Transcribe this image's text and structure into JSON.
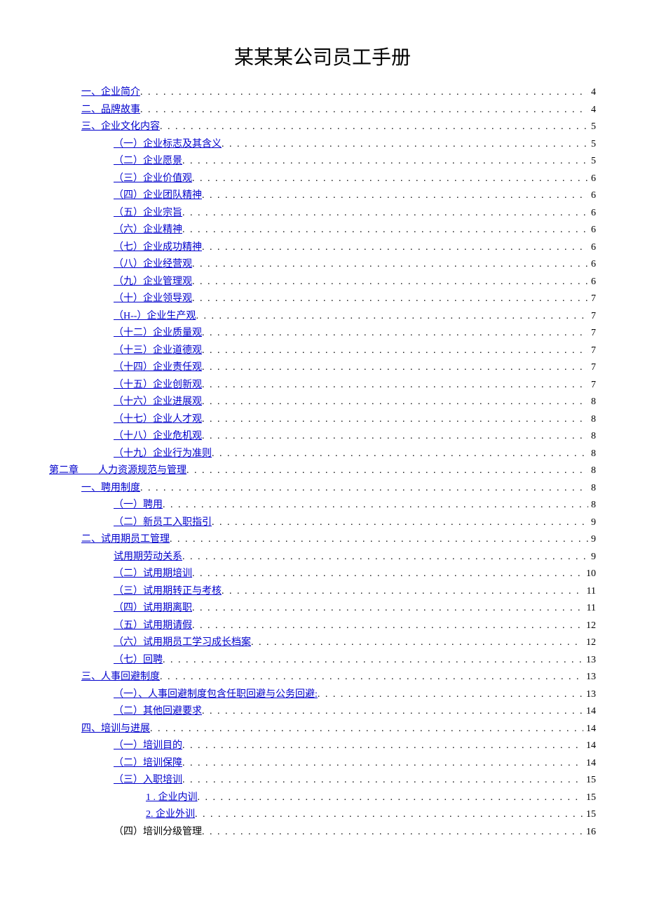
{
  "title": "某某某公司员工手册",
  "toc": [
    {
      "label": "一、企业简介",
      "page": "4",
      "indent": 1,
      "link": true
    },
    {
      "label": "二、品牌故事",
      "page": "4",
      "indent": 1,
      "link": true
    },
    {
      "label": "三、企业文化内容",
      "page": "5",
      "indent": 1,
      "link": true
    },
    {
      "label": "（一）企业标志及其含义",
      "page": "5",
      "indent": 2,
      "link": true
    },
    {
      "label": "（二）企业愿景",
      "page": "5",
      "indent": 2,
      "link": true
    },
    {
      "label": "（三）企业价值观",
      "page": "6",
      "indent": 2,
      "link": true
    },
    {
      "label": "（四）企业团队精神",
      "page": "6",
      "indent": 2,
      "link": true
    },
    {
      "label": "（五）企业宗旨",
      "page": "6",
      "indent": 2,
      "link": true
    },
    {
      "label": "（六）企业精神",
      "page": "6",
      "indent": 2,
      "link": true
    },
    {
      "label": "（七）企业成功精神",
      "page": "6",
      "indent": 2,
      "link": true
    },
    {
      "label": "（八）企业经营观",
      "page": "6",
      "indent": 2,
      "link": true
    },
    {
      "label": "（九）企业管理观",
      "page": "6",
      "indent": 2,
      "link": true
    },
    {
      "label": "（十）企业领导观",
      "page": "7",
      "indent": 2,
      "link": true
    },
    {
      "label": "（H--）企业生产观",
      "page": "7",
      "indent": 2,
      "link": true
    },
    {
      "label": "（十二）企业质量观",
      "page": "7",
      "indent": 2,
      "link": true
    },
    {
      "label": "（十三）企业道德观",
      "page": "7",
      "indent": 2,
      "link": true
    },
    {
      "label": "（十四）企业责任观",
      "page": "7",
      "indent": 2,
      "link": true
    },
    {
      "label": "（十五）企业创新观",
      "page": "7",
      "indent": 2,
      "link": true
    },
    {
      "label": "（十六）企业进展观",
      "page": "8",
      "indent": 2,
      "link": true
    },
    {
      "label": "（十七）企业人才观",
      "page": "8",
      "indent": 2,
      "link": true
    },
    {
      "label": "（十八）企业危机观",
      "page": "8",
      "indent": 2,
      "link": true
    },
    {
      "label": "（十九）企业行为准则",
      "page": "8",
      "indent": 2,
      "link": true
    },
    {
      "label": "第二章　　人力资源规范与管理",
      "page": "8",
      "indent": 0,
      "link": true
    },
    {
      "label": "一、聘用制度",
      "page": "8",
      "indent": 1,
      "link": true
    },
    {
      "label": "（一）聘用",
      "page": "8",
      "indent": 2,
      "link": true
    },
    {
      "label": "（二）新员工入职指引",
      "page": "9",
      "indent": 2,
      "link": true
    },
    {
      "label": "二、试用期员工管理",
      "page": "9",
      "indent": 1,
      "link": true
    },
    {
      "label": "试用期劳动关系",
      "page": "9",
      "indent": 2,
      "link": true
    },
    {
      "label": "（二）试用期培训",
      "page": "10",
      "indent": 2,
      "link": true
    },
    {
      "label": "（三）试用期转正与考核",
      "page": "11",
      "indent": 2,
      "link": true
    },
    {
      "label": "（四）试用期离职",
      "page": "11",
      "indent": 2,
      "link": true
    },
    {
      "label": "（五）试用期请假",
      "page": "12",
      "indent": 2,
      "link": true
    },
    {
      "label": "（六）试用期员工学习成长档案",
      "page": "12",
      "indent": 2,
      "link": true
    },
    {
      "label": "（七）回聘",
      "page": "13",
      "indent": 2,
      "link": true
    },
    {
      "label": "三、人事回避制度",
      "page": "13",
      "indent": 1,
      "link": true
    },
    {
      "label": "（一）、人事回避制度包含任职回避与公务回避:",
      "page": "13",
      "indent": 2,
      "link": true
    },
    {
      "label": "（二）其他回避要求",
      "page": "14",
      "indent": 2,
      "link": true
    },
    {
      "label": "四、培训与进展",
      "page": "14",
      "indent": 1,
      "link": true
    },
    {
      "label": "（一）培训目的",
      "page": "14",
      "indent": 2,
      "link": true
    },
    {
      "label": "（二）培训保障",
      "page": "14",
      "indent": 2,
      "link": true
    },
    {
      "label": "（三）入职培训",
      "page": "15",
      "indent": 2,
      "link": true
    },
    {
      "label": "1 . 企业内训",
      "page": "15",
      "indent": 3,
      "link": true
    },
    {
      "label": "2. 企业外训",
      "page": "15",
      "indent": 3,
      "link": true
    },
    {
      "label": "（四）培训分级管理",
      "page": "16",
      "indent": 2,
      "link": false
    }
  ]
}
